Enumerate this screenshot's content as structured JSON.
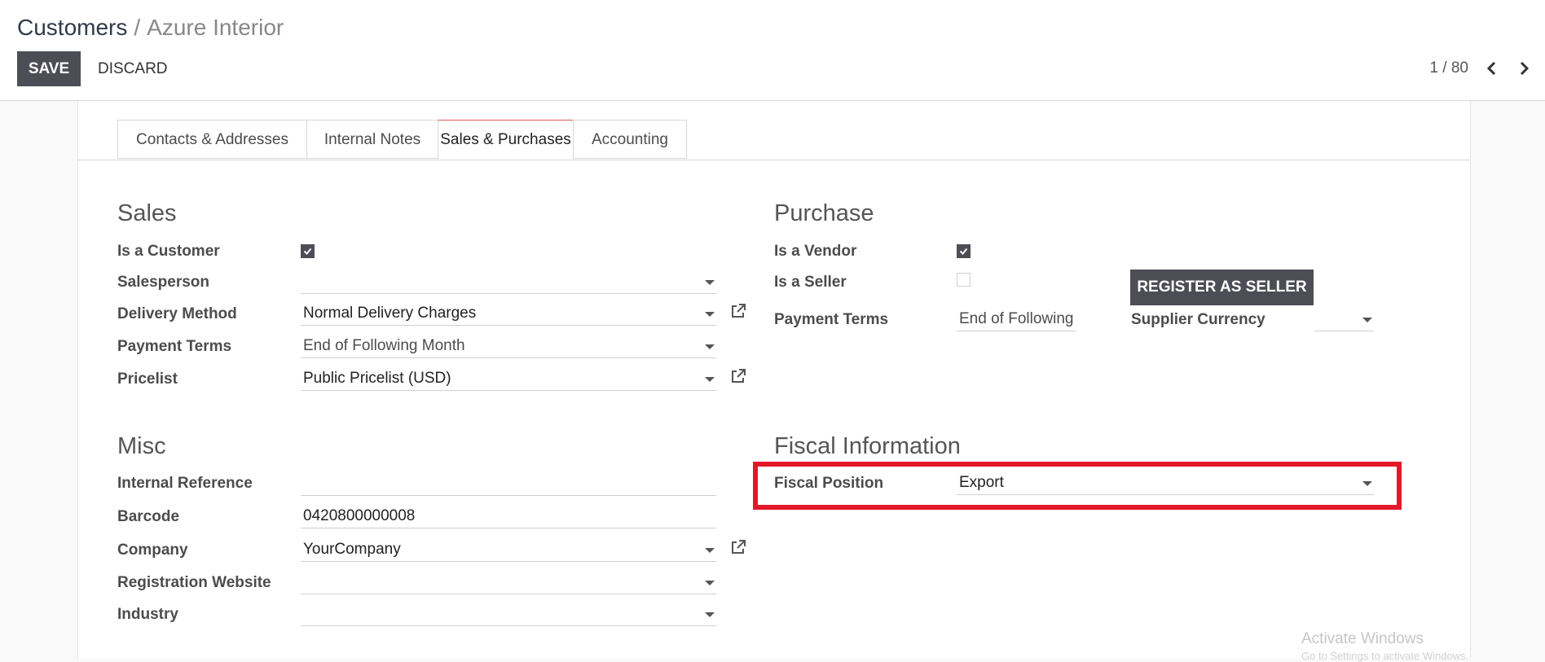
{
  "breadcrumb": {
    "parent": "Customers",
    "separator": "/",
    "current": "Azure Interior"
  },
  "toolbar": {
    "save_label": "SAVE",
    "discard_label": "DISCARD"
  },
  "pager": {
    "text": "1 / 80"
  },
  "tabs": [
    {
      "label": "Contacts & Addresses"
    },
    {
      "label": "Internal Notes"
    },
    {
      "label": "Sales & Purchases",
      "active": true
    },
    {
      "label": "Accounting"
    }
  ],
  "sales": {
    "title": "Sales",
    "is_customer": {
      "label": "Is a Customer",
      "checked": true
    },
    "salesperson": {
      "label": "Salesperson",
      "value": ""
    },
    "delivery_method": {
      "label": "Delivery Method",
      "value": "Normal Delivery Charges"
    },
    "payment_terms": {
      "label": "Payment Terms",
      "value": "End of Following Month"
    },
    "pricelist": {
      "label": "Pricelist",
      "value": "Public Pricelist (USD)"
    }
  },
  "purchase": {
    "title": "Purchase",
    "is_vendor": {
      "label": "Is a Vendor",
      "checked": true
    },
    "is_seller": {
      "label": "Is a Seller",
      "checked": false
    },
    "register_button": "REGISTER AS SELLER",
    "payment_terms": {
      "label": "Payment Terms",
      "value": "End of Following"
    },
    "supplier_currency": {
      "label": "Supplier Currency",
      "value": ""
    }
  },
  "misc": {
    "title": "Misc",
    "internal_reference": {
      "label": "Internal Reference",
      "value": ""
    },
    "barcode": {
      "label": "Barcode",
      "value": "0420800000008"
    },
    "company": {
      "label": "Company",
      "value": "YourCompany"
    },
    "registration_website": {
      "label": "Registration Website",
      "value": ""
    },
    "industry": {
      "label": "Industry",
      "value": ""
    }
  },
  "fiscal": {
    "title": "Fiscal Information",
    "fiscal_position": {
      "label": "Fiscal Position",
      "value": "Export"
    }
  },
  "watermark": {
    "line1": "Activate Windows",
    "line2": "Go to Settings to activate Windows."
  },
  "colors": {
    "primary": "#4d4d56",
    "highlight": "#e3182a",
    "active_tab_accent": "#e05a5a"
  }
}
